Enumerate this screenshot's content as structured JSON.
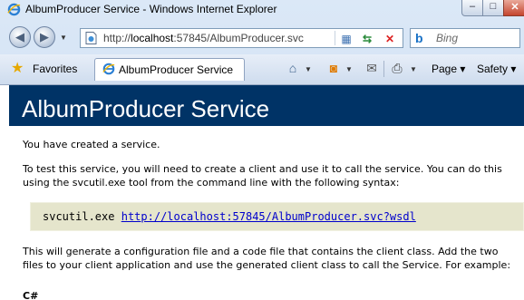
{
  "window": {
    "title": "AlbumProducer Service - Windows Internet Explorer",
    "minimize_glyph": "–",
    "maximize_glyph": "□",
    "close_glyph": "✕"
  },
  "address": {
    "url_prefix": "http://",
    "url_host": "localhost",
    "url_rest": ":57845/AlbumProducer.svc",
    "search_placeholder": "Bing"
  },
  "toolbar": {
    "favorites_label": "Favorites",
    "tab_label": "AlbumProducer Service",
    "page_label": "Page",
    "safety_label": "Safety"
  },
  "page": {
    "heading": "AlbumProducer Service",
    "intro": "You have created a service.",
    "instructions": "To test this service, you will need to create a client and use it to call the service. You can do this using the svcutil.exe tool from the command line with the following syntax:",
    "command": "svcutil.exe",
    "wsdl_link": "http://localhost:57845/AlbumProducer.svc?wsdl",
    "generate_text": "This will generate a configuration file and a code file that contains the client class. Add the two files to your client application and use the generated client class to call the Service. For example:",
    "csharp_label": "C#"
  },
  "icons": [
    "ie-logo-icon",
    "back-arrow-icon",
    "forward-arrow-icon",
    "page-icon",
    "compat-view-icon",
    "refresh-icon",
    "stop-icon",
    "bing-icon",
    "star-icon",
    "home-icon",
    "rss-icon",
    "mail-icon",
    "print-icon"
  ],
  "colors": {
    "banner": "#003366",
    "code_bg": "#e5e5cc",
    "link": "#0000cc"
  }
}
